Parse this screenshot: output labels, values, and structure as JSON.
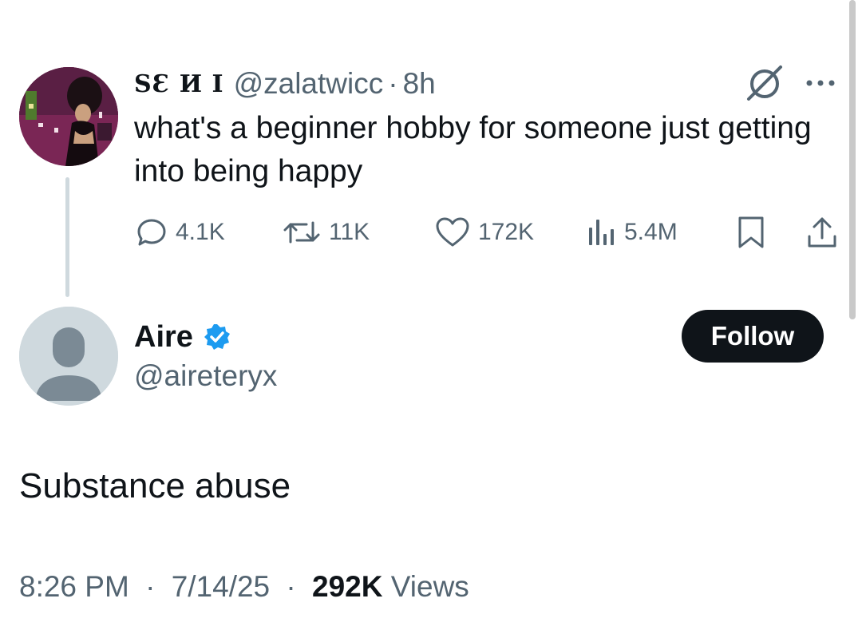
{
  "parent_tweet": {
    "display_name": "SƐ И I",
    "handle": "@zalatwicc",
    "separator": "·",
    "time": "8h",
    "text": "what's a beginner hobby for someone just getting into being happy",
    "icons": {
      "grok": "grok-icon",
      "more": "more-icon"
    },
    "actions": {
      "replies": "4.1K",
      "reposts": "11K",
      "likes": "172K",
      "views": "5.4M"
    }
  },
  "reply": {
    "display_name": "Aire",
    "handle": "@aireteryx",
    "verified": true,
    "follow_label": "Follow",
    "text": "Substance abuse",
    "time": "8:26 PM",
    "date": "7/14/25",
    "separator": "·",
    "views_count": "292K",
    "views_label": "Views"
  },
  "colors": {
    "primary_text": "#0f1419",
    "secondary_text": "#536471",
    "verified_blue": "#1d9bf0",
    "thread_line": "#cfd9de",
    "follow_bg": "#0f1419"
  }
}
